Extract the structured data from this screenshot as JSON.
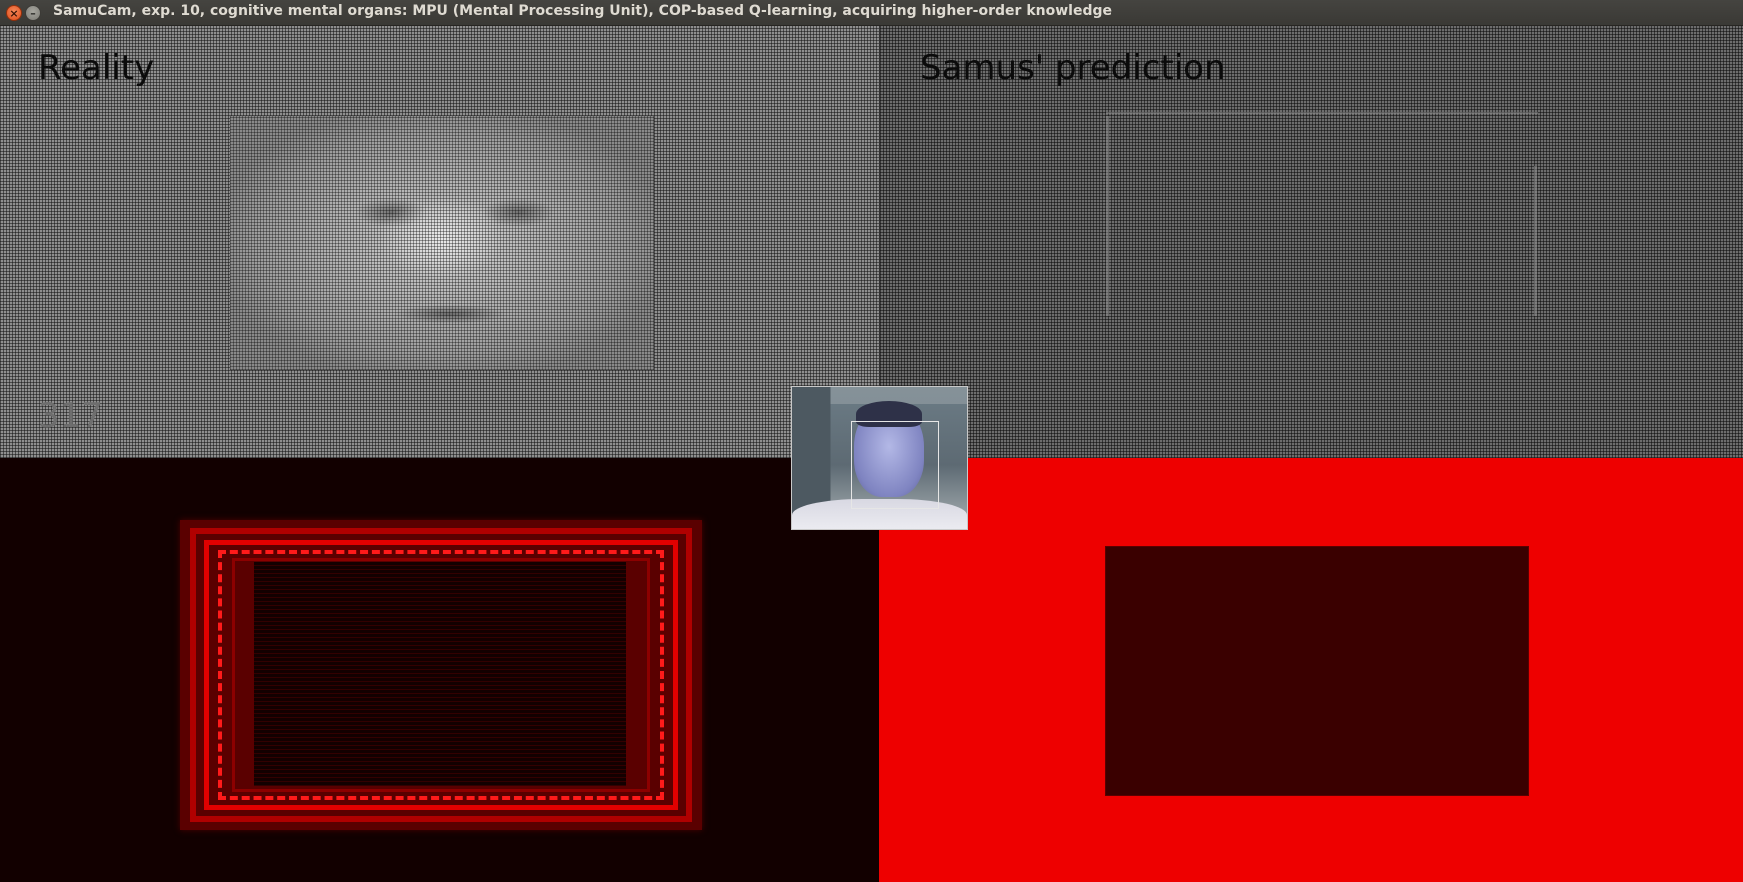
{
  "window": {
    "title": "SamuCam, exp. 10, cognitive mental organs: MPU (Mental Processing Unit), COP-based Q-learning, acquiring higher-order knowledge",
    "close_glyph": "×",
    "minimize_glyph": "–"
  },
  "panels": {
    "reality": {
      "label": "Reality",
      "frame_counter": "317"
    },
    "prediction": {
      "label": "Samus' prediction"
    }
  },
  "colors": {
    "reality_heat_bg": "#120000",
    "prediction_heat_bg": "#ee0000",
    "heat_bright": "#e00000",
    "heat_dark": "#3a0000"
  }
}
